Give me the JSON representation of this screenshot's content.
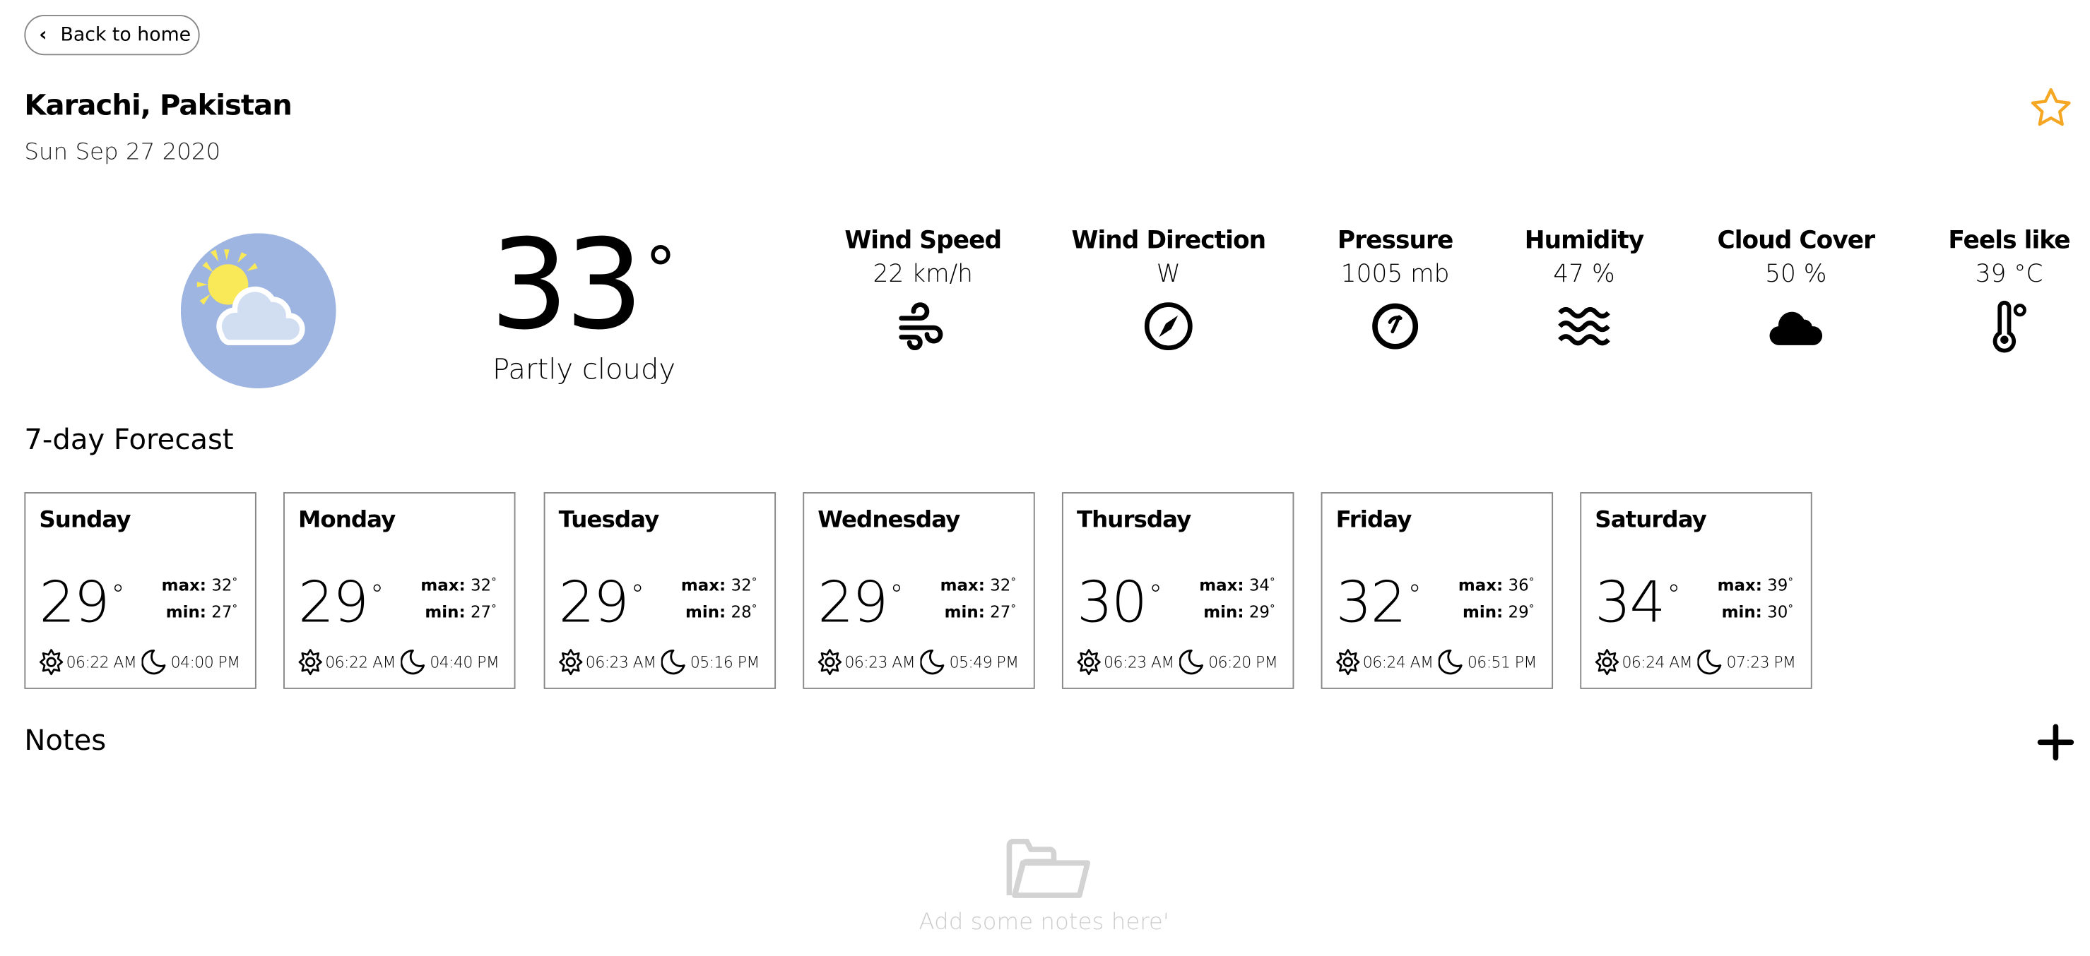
{
  "nav": {
    "back_label": "Back to home"
  },
  "location": {
    "title": "Karachi, Pakistan",
    "date": "Sun Sep 27 2020",
    "favorite_icon": "star-outline-icon",
    "accent": "#f5a623"
  },
  "current": {
    "temp": "33",
    "degree": "°",
    "condition": "Partly cloudy",
    "icon": "partly-cloudy-icon"
  },
  "stats": [
    {
      "label": "Wind Speed",
      "value": "22 km/h",
      "icon": "wind-icon"
    },
    {
      "label": "Wind Direction",
      "value": "W",
      "icon": "compass-icon"
    },
    {
      "label": "Pressure",
      "value": "1005 mb",
      "icon": "gauge-icon"
    },
    {
      "label": "Humidity",
      "value": "47 %",
      "icon": "waves-icon"
    },
    {
      "label": "Cloud Cover",
      "value": "50 %",
      "icon": "cloud-icon"
    },
    {
      "label": "Feels like",
      "value": "39 °C",
      "icon": "thermometer-icon"
    }
  ],
  "forecast": {
    "title": "7-day Forecast",
    "max_label": "max:",
    "min_label": "min:",
    "days": [
      {
        "day": "Sunday",
        "temp": "29",
        "max": "32",
        "min": "27",
        "sunrise": "06:22 AM",
        "sunset": "04:00 PM"
      },
      {
        "day": "Monday",
        "temp": "29",
        "max": "32",
        "min": "27",
        "sunrise": "06:22 AM",
        "sunset": "04:40 PM"
      },
      {
        "day": "Tuesday",
        "temp": "29",
        "max": "32",
        "min": "28",
        "sunrise": "06:23 AM",
        "sunset": "05:16 PM"
      },
      {
        "day": "Wednesday",
        "temp": "29",
        "max": "32",
        "min": "27",
        "sunrise": "06:23 AM",
        "sunset": "05:49 PM"
      },
      {
        "day": "Thursday",
        "temp": "30",
        "max": "34",
        "min": "29",
        "sunrise": "06:23 AM",
        "sunset": "06:20 PM"
      },
      {
        "day": "Friday",
        "temp": "32",
        "max": "36",
        "min": "29",
        "sunrise": "06:24 AM",
        "sunset": "06:51 PM"
      },
      {
        "day": "Saturday",
        "temp": "34",
        "max": "39",
        "min": "30",
        "sunrise": "06:24 AM",
        "sunset": "07:23 PM"
      }
    ]
  },
  "notes": {
    "title": "Notes",
    "empty_text": "Add some notes here'"
  }
}
